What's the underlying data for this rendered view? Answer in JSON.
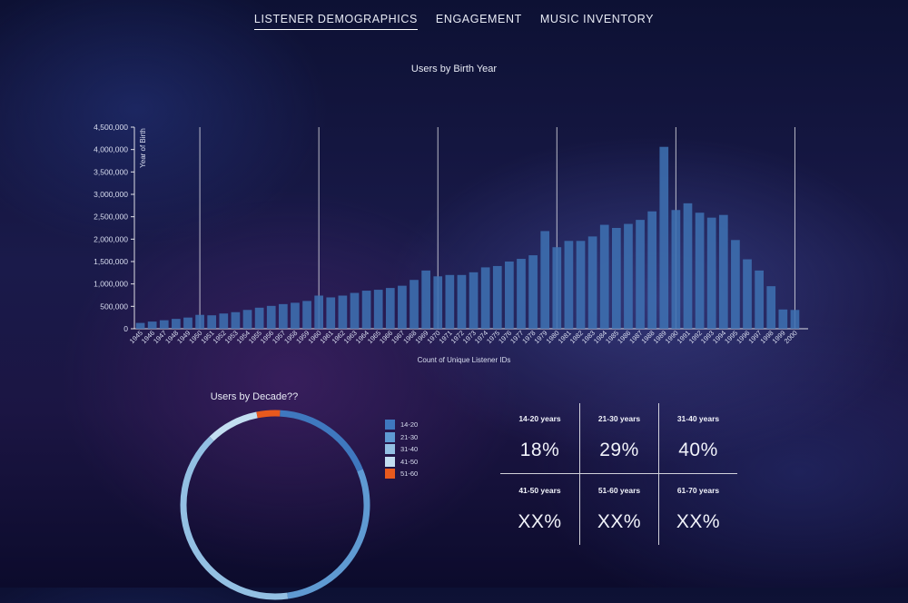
{
  "nav": {
    "tabs": [
      {
        "label": "LISTENER DEMOGRAPHICS",
        "active": true
      },
      {
        "label": "ENGAGEMENT",
        "active": false
      },
      {
        "label": "MUSIC INVENTORY",
        "active": false
      }
    ]
  },
  "chart_data": [
    {
      "type": "bar",
      "title": "Users by Birth Year",
      "xlabel": "Count of Unique Listener IDs",
      "ylabel": "Year of Birth",
      "ylim": [
        0,
        4500000
      ],
      "y_ticks": [
        0,
        500000,
        1000000,
        1500000,
        2000000,
        2500000,
        3000000,
        3500000,
        4000000,
        4500000
      ],
      "y_tick_labels": [
        "0",
        "500,000",
        "1,000,000",
        "1,500,000",
        "2,000,000",
        "2,500,000",
        "3,000,000",
        "3,500,000",
        "4,000,000",
        "4,500,000"
      ],
      "categories": [
        "1945",
        "1946",
        "1947",
        "1948",
        "1949",
        "1950",
        "1951",
        "1952",
        "1953",
        "1954",
        "1955",
        "1956",
        "1957",
        "1958",
        "1959",
        "1960",
        "1961",
        "1962",
        "1963",
        "1964",
        "1965",
        "1966",
        "1967",
        "1968",
        "1969",
        "1970",
        "1971",
        "1972",
        "1973",
        "1974",
        "1975",
        "1976",
        "1977",
        "1978",
        "1979",
        "1980",
        "1981",
        "1982",
        "1983",
        "1984",
        "1985",
        "1986",
        "1987",
        "1988",
        "1989",
        "1990",
        "1991",
        "1992",
        "1993",
        "1994",
        "1995",
        "1996",
        "1997",
        "1998",
        "1999",
        "2000"
      ],
      "values": [
        130000,
        160000,
        190000,
        220000,
        250000,
        310000,
        300000,
        340000,
        370000,
        420000,
        470000,
        510000,
        550000,
        580000,
        620000,
        740000,
        700000,
        740000,
        800000,
        850000,
        870000,
        910000,
        960000,
        1090000,
        1300000,
        1170000,
        1200000,
        1200000,
        1260000,
        1370000,
        1400000,
        1500000,
        1560000,
        1640000,
        2180000,
        1820000,
        1960000,
        1960000,
        2060000,
        2320000,
        2250000,
        2340000,
        2430000,
        2620000,
        4060000,
        2650000,
        2800000,
        2590000,
        2480000,
        2540000,
        1980000,
        1550000,
        1300000,
        950000,
        430000,
        420000
      ],
      "vertical_reference_lines": [
        "1950",
        "1960",
        "1970",
        "1980",
        "1990",
        "2000"
      ],
      "color": "#3d6fb0",
      "grid": false
    },
    {
      "type": "pie",
      "title": "Users by Decade??",
      "categories": [
        "14-20",
        "21-30",
        "31-40",
        "41-50",
        "51-60"
      ],
      "values": [
        18,
        29,
        40,
        9,
        4
      ],
      "colors": [
        "#3f78bf",
        "#5f9ad2",
        "#93c0e3",
        "#c3def1",
        "#e8591d"
      ],
      "donut": true
    }
  ],
  "legend": {
    "items": [
      {
        "label": "14-20",
        "color": "#3f78bf"
      },
      {
        "label": "21-30",
        "color": "#5f9ad2"
      },
      {
        "label": "31-40",
        "color": "#93c0e3"
      },
      {
        "label": "41-50",
        "color": "#c3def1"
      },
      {
        "label": "51-60",
        "color": "#e8591d"
      }
    ]
  },
  "stats": {
    "items": [
      {
        "label": "14-20 years",
        "value": "18%"
      },
      {
        "label": "21-30 years",
        "value": "29%"
      },
      {
        "label": "31-40 years",
        "value": "40%"
      },
      {
        "label": "41-50 years",
        "value": "XX%"
      },
      {
        "label": "51-60 years",
        "value": "XX%"
      },
      {
        "label": "61-70 years",
        "value": "XX%"
      }
    ]
  }
}
